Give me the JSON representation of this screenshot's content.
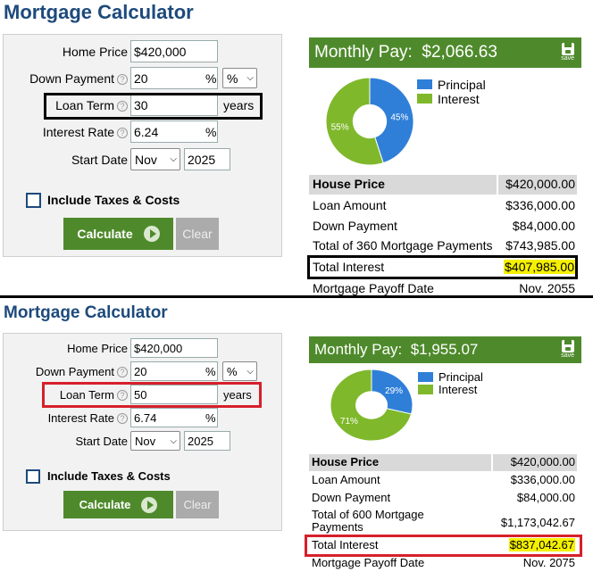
{
  "panels": [
    {
      "title": "Mortgage Calculator",
      "form": {
        "home_price_label": "Home Price",
        "home_price_value": "$420,000",
        "down_payment_label": "Down Payment",
        "down_payment_value": "20",
        "down_payment_unit": "%",
        "down_payment_select": "%",
        "loan_term_label": "Loan Term",
        "loan_term_value": "30",
        "loan_term_unit": "years",
        "interest_rate_label": "Interest Rate",
        "interest_rate_value": "6.24",
        "interest_rate_unit": "%",
        "start_date_label": "Start Date",
        "start_month": "Nov",
        "start_year": "2025",
        "include_taxes_label": "Include Taxes & Costs",
        "calculate_label": "Calculate",
        "clear_label": "Clear"
      },
      "monthly_pay_label": "Monthly Pay:",
      "monthly_pay_value": "$2,066.63",
      "save_label": "save",
      "chart_data": {
        "type": "pie",
        "categories": [
          "Principal",
          "Interest"
        ],
        "values": [
          45,
          55
        ],
        "labels": [
          "45%",
          "55%"
        ],
        "colors": [
          "#2f7fd8",
          "#7fb82b"
        ],
        "legend": "top-right"
      },
      "results": {
        "header_label": "House Price",
        "header_value": "$420,000.00",
        "loan_amount_label": "Loan Amount",
        "loan_amount_value": "$336,000.00",
        "down_payment_label": "Down Payment",
        "down_payment_value": "$84,000.00",
        "total_payments_label": "Total of 360 Mortgage Payments",
        "total_payments_value": "$743,985.00",
        "total_interest_label": "Total Interest",
        "total_interest_value": "$407,985.00",
        "payoff_label": "Mortgage Payoff Date",
        "payoff_value": "Nov. 2055"
      },
      "highlight_color": "#000000"
    },
    {
      "title": "Mortgage Calculator",
      "form": {
        "home_price_label": "Home Price",
        "home_price_value": "$420,000",
        "down_payment_label": "Down Payment",
        "down_payment_value": "20",
        "down_payment_unit": "%",
        "down_payment_select": "%",
        "loan_term_label": "Loan Term",
        "loan_term_value": "50",
        "loan_term_unit": "years",
        "interest_rate_label": "Interest Rate",
        "interest_rate_value": "6.74",
        "interest_rate_unit": "%",
        "start_date_label": "Start Date",
        "start_month": "Nov",
        "start_year": "2025",
        "include_taxes_label": "Include Taxes & Costs",
        "calculate_label": "Calculate",
        "clear_label": "Clear"
      },
      "monthly_pay_label": "Monthly Pay:",
      "monthly_pay_value": "$1,955.07",
      "save_label": "save",
      "chart_data": {
        "type": "pie",
        "categories": [
          "Principal",
          "Interest"
        ],
        "values": [
          29,
          71
        ],
        "labels": [
          "29%",
          "71%"
        ],
        "colors": [
          "#2f7fd8",
          "#7fb82b"
        ],
        "legend": "top-right"
      },
      "results": {
        "header_label": "House Price",
        "header_value": "$420,000.00",
        "loan_amount_label": "Loan Amount",
        "loan_amount_value": "$336,000.00",
        "down_payment_label": "Down Payment",
        "down_payment_value": "$84,000.00",
        "total_payments_label": "Total of 600 Mortgage Payments",
        "total_payments_value": "$1,173,042.67",
        "total_interest_label": "Total Interest",
        "total_interest_value": "$837,042.67",
        "payoff_label": "Mortgage Payoff Date",
        "payoff_value": "Nov. 2075"
      },
      "highlight_color": "#d6202b"
    }
  ]
}
